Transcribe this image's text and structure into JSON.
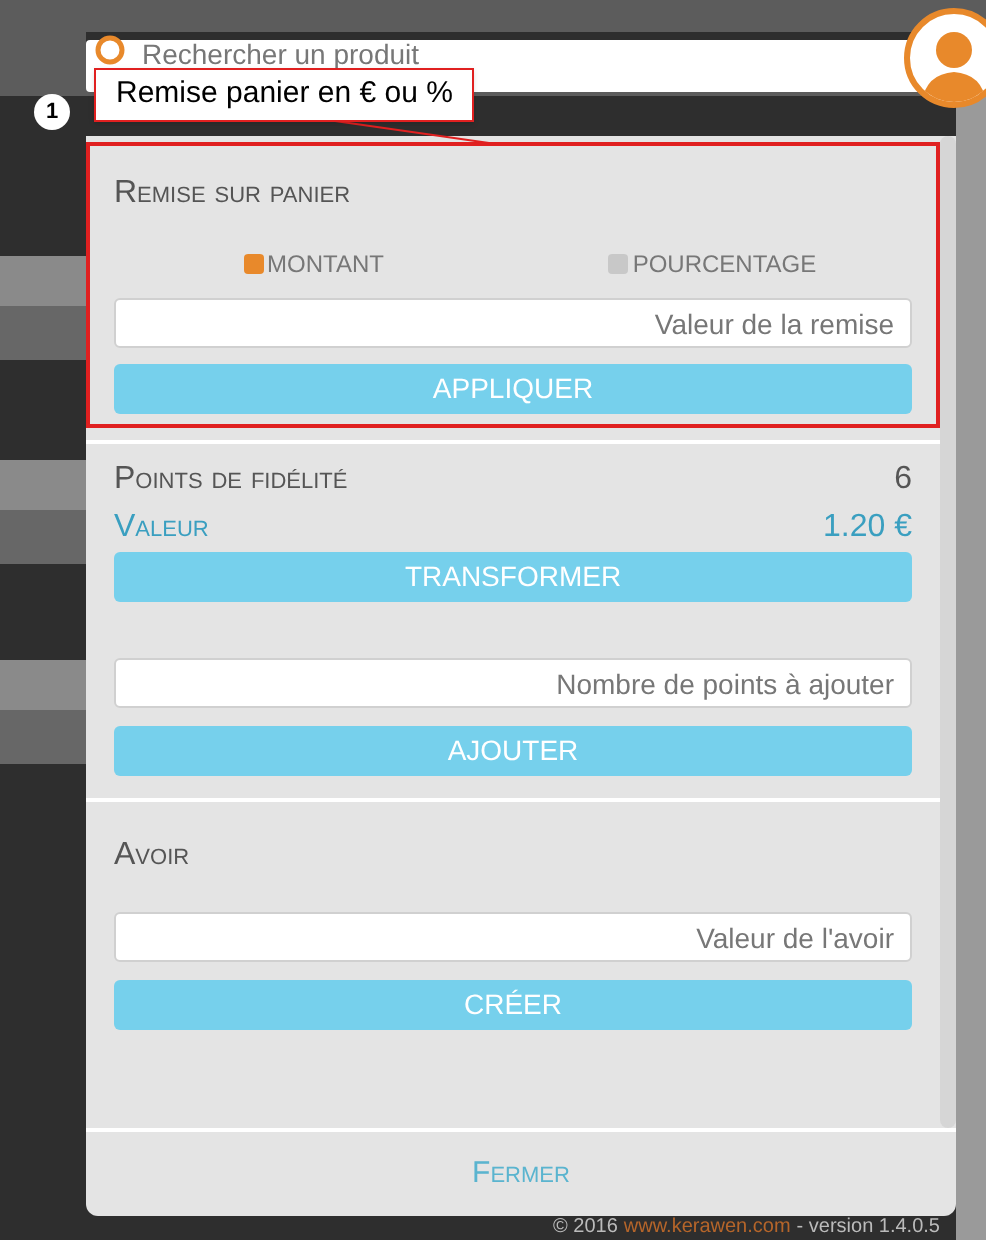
{
  "search": {
    "placeholder": "Rechercher un produit"
  },
  "callout": {
    "number": "1",
    "text": "Remise panier en € ou %"
  },
  "discount": {
    "title": "Remise sur panier",
    "modes": [
      {
        "label": "MONTANT",
        "selected": true
      },
      {
        "label": "POURCENTAGE",
        "selected": false
      }
    ],
    "placeholder": "Valeur de la remise",
    "button": "APPLIQUER",
    "highlighted": true
  },
  "loyalty": {
    "title": "Points de fidélité",
    "points": "6",
    "value_label": "Valeur",
    "value": "1.20 €",
    "transform_button": "TRANSFORMER",
    "placeholder": "Nombre de points à ajouter",
    "add_button": "AJOUTER"
  },
  "credit": {
    "title": "Avoir",
    "placeholder": "Valeur de l'avoir",
    "button": "CRÉER"
  },
  "close_button": "Fermer",
  "footer": {
    "copyright": "© 2016",
    "link": "www.kerawen.com",
    "version": "- version 1.4.0.5"
  }
}
